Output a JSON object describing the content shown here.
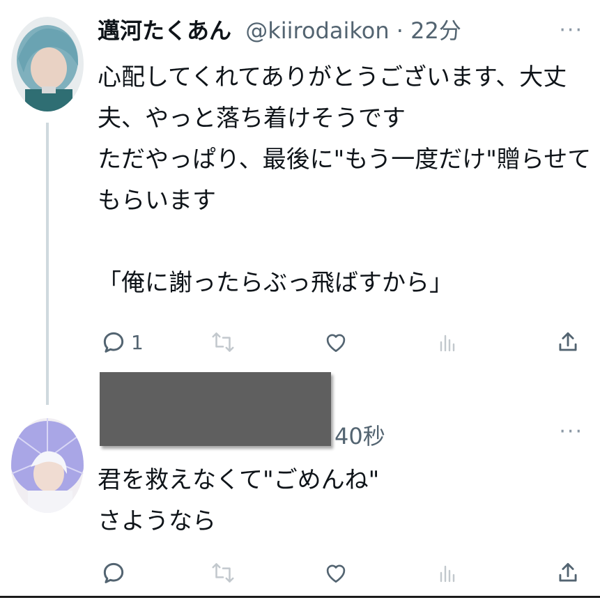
{
  "tweets": [
    {
      "author_name": "邁河たくあん",
      "handle": "@kiirodaikon",
      "separator": "·",
      "time": "22分",
      "more": "···",
      "text": "心配してくれてありがとうございます、大丈\n夫、やっと落ち着けそうです\nただやっぱり、最後に\"もう一度だけ\"贈らせて\nもらいます\n\n「俺に謝ったらぶっ飛ばすから」",
      "actions": {
        "reply_count": "1",
        "retweet_count": "",
        "like_count": ""
      }
    },
    {
      "author_name": "",
      "handle": "",
      "time": "40秒",
      "more": "···",
      "text": "君を救えなくて\"ごめんね\"\nさようなら",
      "actions": {
        "reply_count": "",
        "retweet_count": "",
        "like_count": ""
      }
    }
  ],
  "icons": [
    "reply-icon",
    "retweet-icon",
    "like-icon",
    "analytics-icon",
    "share-icon",
    "more-icon"
  ],
  "colors": {
    "text": "#0f1419",
    "muted": "#536471",
    "faint": "#cfd9de",
    "redaction": "#5f5f5f"
  }
}
